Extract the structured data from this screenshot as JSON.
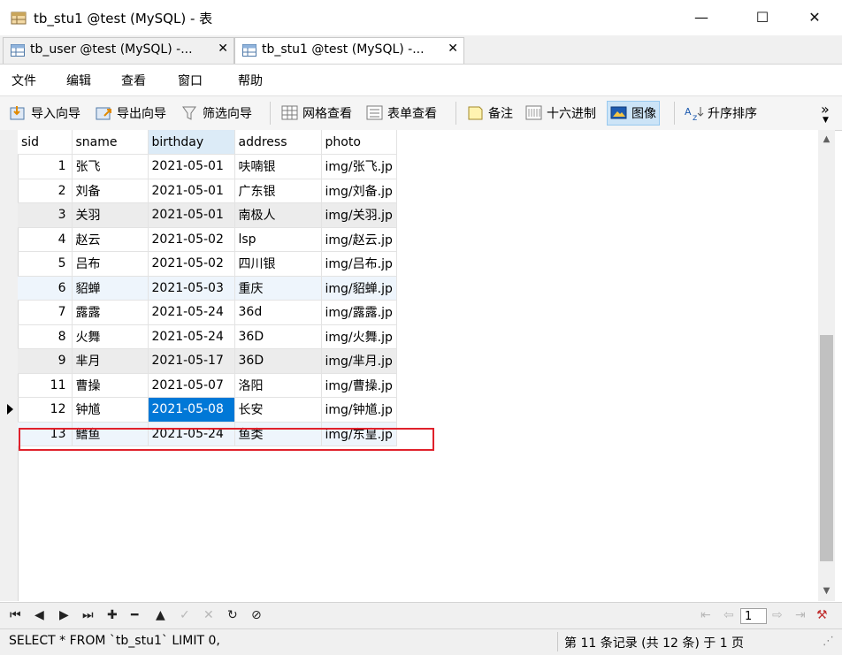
{
  "window": {
    "title": "tb_stu1 @test (MySQL) - 表",
    "minimize": "—",
    "maximize": "☐",
    "close": "✕"
  },
  "tabs": [
    {
      "label": "tb_user @test (MySQL) -...",
      "close": "✕",
      "active": false
    },
    {
      "label": "tb_stu1 @test (MySQL) -...",
      "close": "✕",
      "active": true
    }
  ],
  "menu": [
    "文件",
    "编辑",
    "查看",
    "窗口",
    "帮助"
  ],
  "toolbar": {
    "import_wizard": "导入向导",
    "export_wizard": "导出向导",
    "filter_wizard": "筛选向导",
    "grid_view": "网格查看",
    "form_view": "表单查看",
    "memo": "备注",
    "hex": "十六进制",
    "image": "图像",
    "sort_asc": "升序排序",
    "overflow": "»"
  },
  "grid": {
    "columns": [
      "sid",
      "sname",
      "birthday",
      "address",
      "photo"
    ],
    "rows": [
      {
        "sid": "1",
        "sname": "张飞",
        "birthday": "2021-05-01",
        "address": "呋喃银",
        "photo": "img/张飞.jp"
      },
      {
        "sid": "2",
        "sname": "刘备",
        "birthday": "2021-05-01",
        "address": "广东银",
        "photo": "img/刘备.jp"
      },
      {
        "sid": "3",
        "sname": "关羽",
        "birthday": "2021-05-01",
        "address": "南极人",
        "photo": "img/关羽.jp"
      },
      {
        "sid": "4",
        "sname": "赵云",
        "birthday": "2021-05-02",
        "address": "lsp",
        "photo": "img/赵云.jp"
      },
      {
        "sid": "5",
        "sname": "吕布",
        "birthday": "2021-05-02",
        "address": "四川银",
        "photo": "img/吕布.jp"
      },
      {
        "sid": "6",
        "sname": "貂蝉",
        "birthday": "2021-05-03",
        "address": "重庆",
        "photo": "img/貂蝉.jp"
      },
      {
        "sid": "7",
        "sname": "露露",
        "birthday": "2021-05-24",
        "address": "36d",
        "photo": "img/露露.jp"
      },
      {
        "sid": "8",
        "sname": "火舞",
        "birthday": "2021-05-24",
        "address": "36D",
        "photo": "img/火舞.jp"
      },
      {
        "sid": "9",
        "sname": "芈月",
        "birthday": "2021-05-17",
        "address": "36D",
        "photo": "img/芈月.jp"
      },
      {
        "sid": "11",
        "sname": "曹操",
        "birthday": "2021-05-07",
        "address": "洛阳",
        "photo": "img/曹操.jp"
      },
      {
        "sid": "12",
        "sname": "钟馗",
        "birthday": "2021-05-08",
        "address": "长安",
        "photo": "img/钟馗.jp"
      },
      {
        "sid": "13",
        "sname": "鳍鱼",
        "birthday": "2021-05-24",
        "address": "鱼类",
        "photo": "img/东皇.jp"
      }
    ],
    "selected_row": 10,
    "selected_column": "birthday",
    "highlighted_row": 11
  },
  "nav": {
    "first": "⏮",
    "prev": "◀",
    "next": "▶",
    "last": "⏭",
    "add": "✚",
    "delete": "━",
    "apply": "▲",
    "confirm": "✓",
    "discard": "✕",
    "refresh": "↻",
    "stop": "⊘",
    "page_first": "⇤",
    "page_prev": "⇦",
    "page_value": "1",
    "page_next": "⇨",
    "page_last": "⇥",
    "settings": "⚒"
  },
  "status": {
    "sql": "SELECT * FROM `tb_stu1` LIMIT 0,",
    "record_info": "第 11 条记录 (共 12 条) 于 1 页"
  }
}
